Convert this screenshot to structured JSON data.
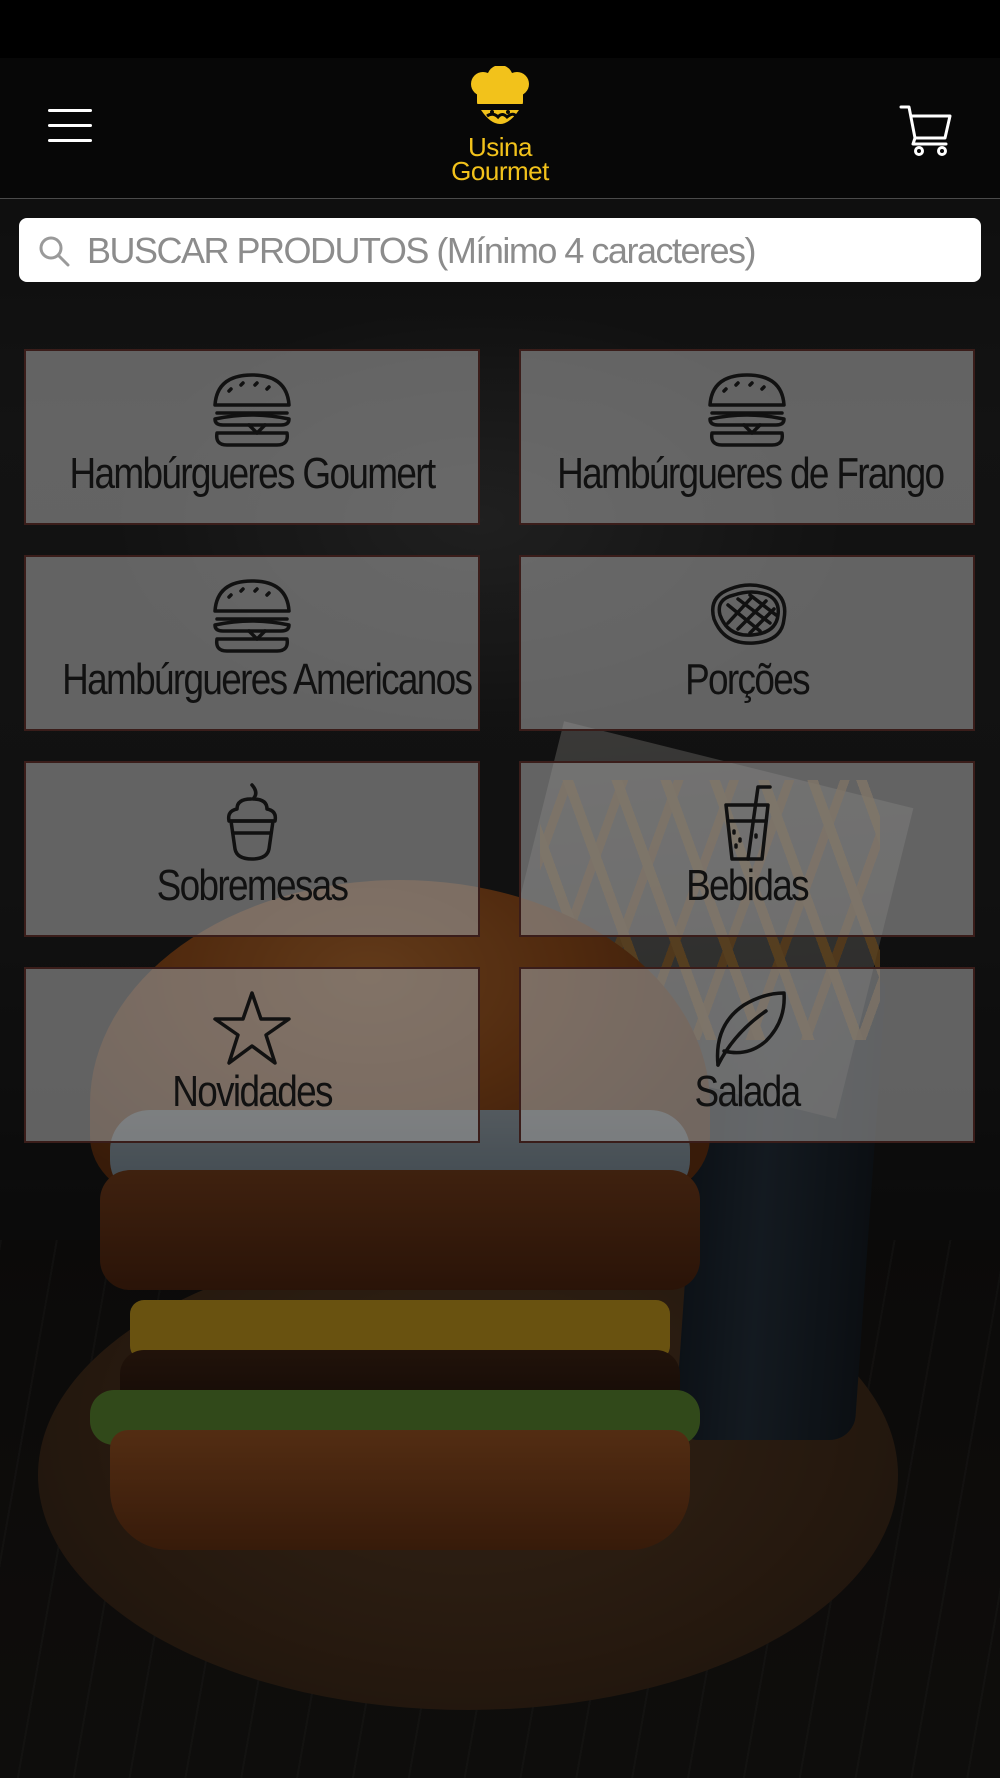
{
  "header": {
    "logo_line1": "Usina",
    "logo_line2": "Gourmet",
    "menu_icon": "hamburger-menu-icon",
    "cart_icon": "shopping-cart-icon"
  },
  "search": {
    "placeholder": "BUSCAR PRODUTOS (Mínimo 4 caracteres)",
    "icon": "search-icon"
  },
  "categories": [
    {
      "label": "Hambúrgueres Goumert",
      "icon": "burger-icon"
    },
    {
      "label": "Hambúrgueres de Frango",
      "icon": "burger-icon"
    },
    {
      "label": "Hambúrgueres Americanos",
      "icon": "burger-icon"
    },
    {
      "label": "Porções",
      "icon": "steak-icon"
    },
    {
      "label": "Sobremesas",
      "icon": "ice-cream-icon"
    },
    {
      "label": "Bebidas",
      "icon": "drink-icon"
    },
    {
      "label": "Novidades",
      "icon": "star-icon"
    },
    {
      "label": "Salada",
      "icon": "leaf-icon"
    }
  ],
  "colors": {
    "brand": "#f2c21b",
    "header_bg": "#070707",
    "tile_border": "#3a1d1a"
  }
}
